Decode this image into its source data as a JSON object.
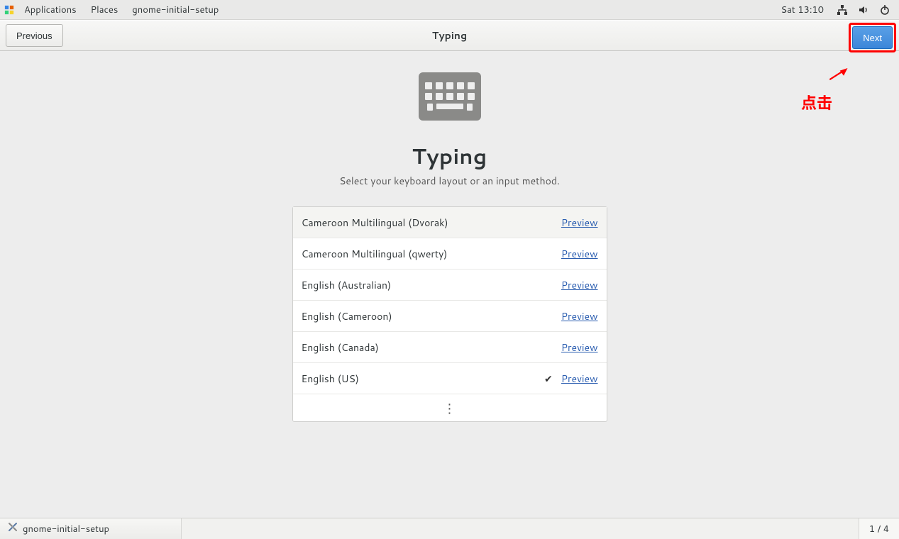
{
  "top_panel": {
    "applications": "Applications",
    "places": "Places",
    "app_name": "gnome-initial-setup",
    "clock": "Sat 13:10"
  },
  "header": {
    "previous": "Previous",
    "title": "Typing",
    "next": "Next"
  },
  "page": {
    "title": "Typing",
    "subtitle": "Select your keyboard layout or an input method."
  },
  "layouts": [
    {
      "label": "Cameroon Multilingual (Dvorak)",
      "selected": false,
      "preview": "Preview"
    },
    {
      "label": "Cameroon Multilingual (qwerty)",
      "selected": false,
      "preview": "Preview"
    },
    {
      "label": "English (Australian)",
      "selected": false,
      "preview": "Preview"
    },
    {
      "label": "English (Cameroon)",
      "selected": false,
      "preview": "Preview"
    },
    {
      "label": "English (Canada)",
      "selected": false,
      "preview": "Preview"
    },
    {
      "label": "English (US)",
      "selected": true,
      "preview": "Preview"
    }
  ],
  "annotation": {
    "label": "点击"
  },
  "task_panel": {
    "app": "gnome-initial-setup",
    "page_indicator": "1 / 4"
  }
}
